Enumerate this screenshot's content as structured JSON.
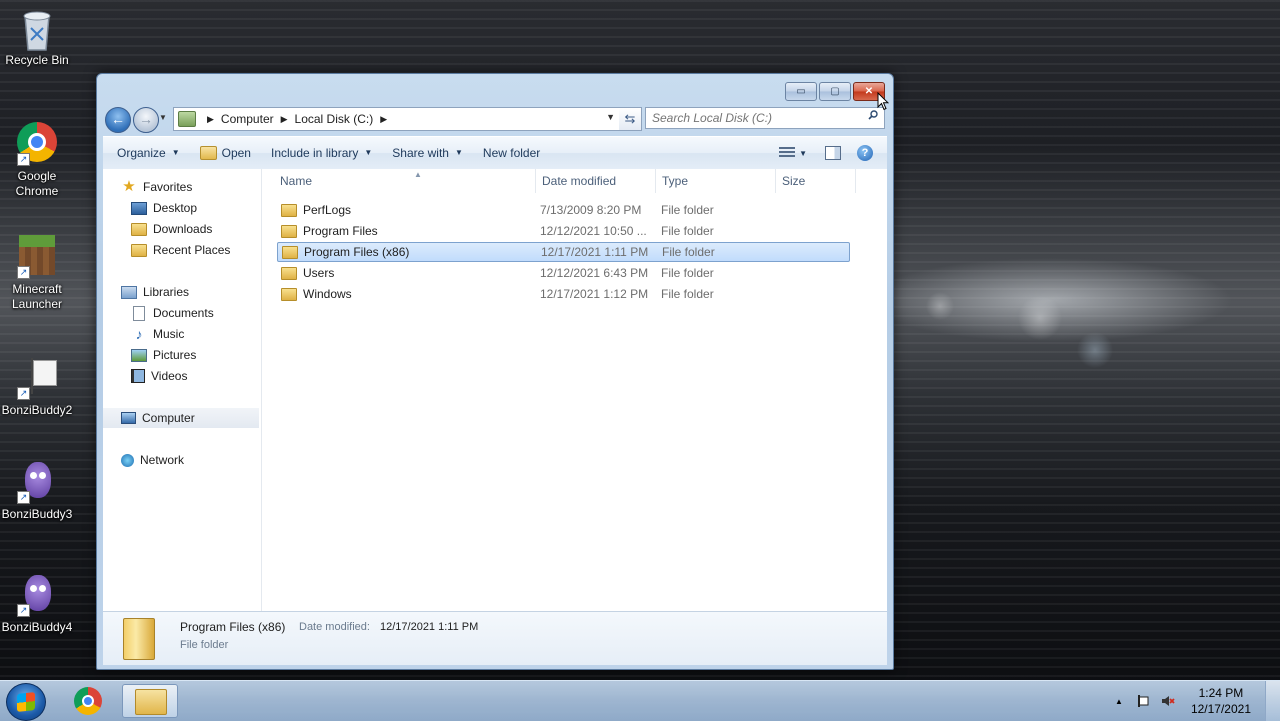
{
  "desktop": {
    "icons": [
      {
        "label": "Recycle Bin",
        "icon": "recycle-bin-icon"
      },
      {
        "label": "Google Chrome",
        "icon": "chrome-icon"
      },
      {
        "label": "Minecraft Launcher",
        "icon": "minecraft-icon"
      },
      {
        "label": "BonziBuddy2",
        "icon": "white-flag-icon"
      },
      {
        "label": "BonziBuddy3",
        "icon": "purple-gorilla-icon"
      },
      {
        "label": "BonziBuddy4",
        "icon": "purple-gorilla-icon"
      }
    ]
  },
  "window": {
    "buttons": {
      "minimize": "▭",
      "maximize": "▢",
      "close": "✕"
    },
    "address": {
      "crumbs": [
        "Computer",
        "Local Disk (C:)"
      ]
    },
    "search": {
      "placeholder": "Search Local Disk (C:)"
    },
    "toolbar": {
      "organize": "Organize",
      "open": "Open",
      "include_in_library": "Include in library",
      "share_with": "Share with",
      "new_folder": "New folder",
      "help": "?"
    },
    "nav_pane": {
      "favorites": "Favorites",
      "desktop": "Desktop",
      "downloads": "Downloads",
      "recent_places": "Recent Places",
      "libraries": "Libraries",
      "documents": "Documents",
      "music": "Music",
      "pictures": "Pictures",
      "videos": "Videos",
      "computer": "Computer",
      "network": "Network"
    },
    "columns": {
      "name": "Name",
      "date_modified": "Date modified",
      "type": "Type",
      "size": "Size"
    },
    "files": [
      {
        "name": "PerfLogs",
        "date": "7/13/2009 8:20 PM",
        "type": "File folder"
      },
      {
        "name": "Program Files",
        "date": "12/12/2021 10:50 ...",
        "type": "File folder"
      },
      {
        "name": "Program Files (x86)",
        "date": "12/17/2021 1:11 PM",
        "type": "File folder",
        "selected": true
      },
      {
        "name": "Users",
        "date": "12/12/2021 6:43 PM",
        "type": "File folder"
      },
      {
        "name": "Windows",
        "date": "12/17/2021 1:12 PM",
        "type": "File folder"
      }
    ],
    "details": {
      "name": "Program Files (x86)",
      "date_label": "Date modified:",
      "date_value": "12/17/2021 1:11 PM",
      "type": "File folder"
    }
  },
  "taskbar": {
    "pinned": [
      {
        "app": "Google Chrome",
        "icon": "chrome-icon"
      },
      {
        "app": "Windows Explorer",
        "icon": "explorer-folder-icon",
        "active": true
      }
    ],
    "tray": {
      "overflow": "▲"
    },
    "clock": {
      "time": "1:24 PM",
      "date": "12/17/2021"
    }
  },
  "colors": {
    "selection": "#c1dcfc",
    "window_frame": "#b5cde6",
    "taskbar": "#a5bed8"
  }
}
